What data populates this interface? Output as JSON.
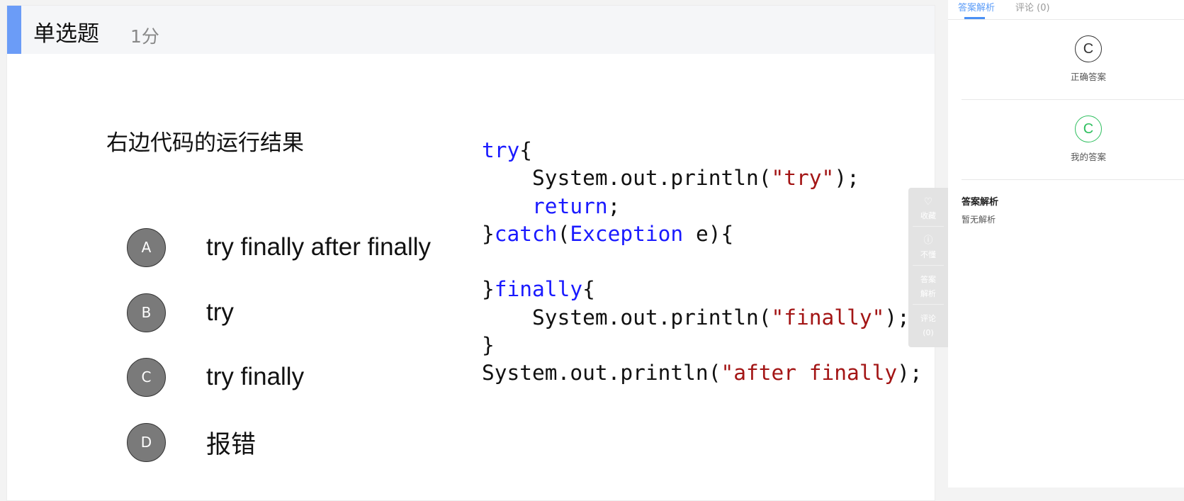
{
  "question": {
    "type": "单选题",
    "score": "1分",
    "text": "右边代码的运行结果",
    "options": [
      {
        "letter": "A",
        "text": "try finally after finally"
      },
      {
        "letter": "B",
        "text": "try"
      },
      {
        "letter": "C",
        "text": "try finally"
      },
      {
        "letter": "D",
        "text": "报错"
      }
    ],
    "code": [
      [
        {
          "t": "try",
          "c": "kw"
        },
        {
          "t": "{",
          "c": ""
        }
      ],
      [
        {
          "t": "    System.out.println(",
          "c": ""
        },
        {
          "t": "\"try\"",
          "c": "str"
        },
        {
          "t": ");",
          "c": ""
        }
      ],
      [
        {
          "t": "    ",
          "c": ""
        },
        {
          "t": "return",
          "c": "kw"
        },
        {
          "t": ";",
          "c": ""
        }
      ],
      [
        {
          "t": "}",
          "c": ""
        },
        {
          "t": "catch",
          "c": "kw"
        },
        {
          "t": "(",
          "c": ""
        },
        {
          "t": "Exception",
          "c": "kw"
        },
        {
          "t": " e){",
          "c": ""
        }
      ],
      [
        {
          "t": "",
          "c": ""
        }
      ],
      [
        {
          "t": "}",
          "c": ""
        },
        {
          "t": "finally",
          "c": "kw"
        },
        {
          "t": "{",
          "c": ""
        }
      ],
      [
        {
          "t": "    System.out.println(",
          "c": ""
        },
        {
          "t": "\"finally\"",
          "c": "str"
        },
        {
          "t": ");",
          "c": ""
        }
      ],
      [
        {
          "t": "}",
          "c": ""
        }
      ],
      [
        {
          "t": "System.out.println(",
          "c": ""
        },
        {
          "t": "\"after finally",
          "c": "str"
        },
        {
          "t": ");",
          "c": ""
        }
      ]
    ]
  },
  "tools": {
    "favorite": "收藏",
    "dont_understand": "不懂",
    "analysis_1": "答案",
    "analysis_2": "解析",
    "comment": "评论",
    "comment_count": "(0)"
  },
  "sidebar": {
    "tabs": [
      {
        "label": "答案解析",
        "active": true
      },
      {
        "label": "评论 (0)",
        "active": false
      }
    ],
    "correct_answer": "C",
    "correct_label": "正确答案",
    "my_answer": "C",
    "my_label": "我的答案",
    "analysis_title": "答案解析",
    "analysis_text": "暂无解析"
  },
  "colors": {
    "accent": "#4a90f5",
    "correct": "#2fbf5f",
    "keyword": "#1a1aff",
    "string": "#a31515"
  }
}
